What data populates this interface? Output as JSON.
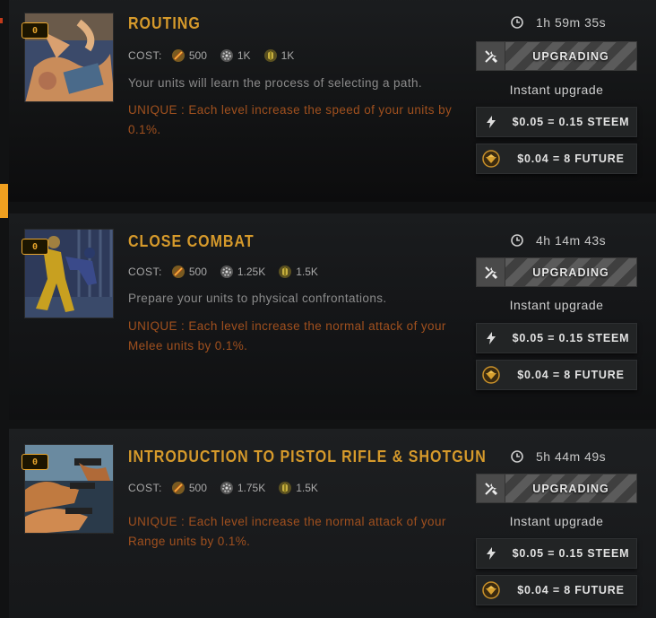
{
  "cost_label": "COST:",
  "instant_label": "Instant upgrade",
  "upgrading_label": "UPGRADING",
  "colors": {
    "accent": "#d69a2b",
    "unique_text": "#a0501e",
    "badge": "#e8a52c",
    "edge_marker": "#f0a020"
  },
  "icons": {
    "timer": "clock-icon",
    "upgrading": "tools-icon",
    "steem": "lightning-icon",
    "future": "future-coin-icon",
    "res1": "ammo-resource-icon",
    "res2": "gear-resource-icon",
    "res3": "gold-resource-icon"
  },
  "trainings": [
    {
      "level": "0",
      "title": "ROUTING",
      "cost": {
        "res1": "500",
        "res2": "1K",
        "res3": "1K"
      },
      "description": "Your units will learn the process of selecting a path.",
      "unique": "UNIQUE : Each level increase the speed of your units by 0.1%.",
      "timer": "1h 59m 35s",
      "steem_price": "$0.05 = 0.15 STEEM",
      "future_price": "$0.04 = 8 FUTURE"
    },
    {
      "level": "0",
      "title": "CLOSE COMBAT",
      "cost": {
        "res1": "500",
        "res2": "1.25K",
        "res3": "1.5K"
      },
      "description": "Prepare your units to physical confrontations.",
      "unique": "UNIQUE : Each level increase the normal attack of your Melee units by 0.1%.",
      "timer": "4h 14m 43s",
      "steem_price": "$0.05 = 0.15 STEEM",
      "future_price": "$0.04 = 8 FUTURE"
    },
    {
      "level": "0",
      "title": "INTRODUCTION TO PISTOL RIFLE & SHOTGUN",
      "cost": {
        "res1": "500",
        "res2": "1.75K",
        "res3": "1.5K"
      },
      "description": "",
      "unique": "UNIQUE : Each level increase the normal attack of your Range units by 0.1%.",
      "timer": "5h 44m 49s",
      "steem_price": "$0.05 = 0.15 STEEM",
      "future_price": "$0.04 = 8 FUTURE"
    }
  ]
}
